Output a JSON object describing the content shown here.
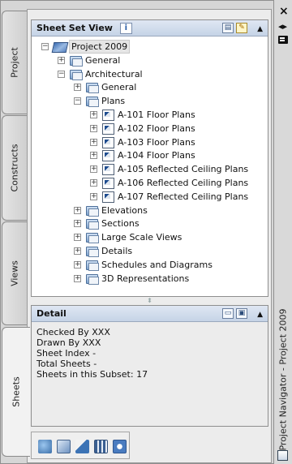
{
  "tabs": [
    {
      "label": "Project"
    },
    {
      "label": "Constructs"
    },
    {
      "label": "Views"
    },
    {
      "label": "Sheets"
    }
  ],
  "sheet_set_view": {
    "title": "Sheet Set View",
    "info_icon": "i"
  },
  "tree": [
    {
      "label": "Project 2009",
      "icon": "project-icon",
      "expander": "−"
    },
    {
      "label": "General",
      "icon": "folder-icon",
      "expander": "+"
    },
    {
      "label": "Architectural",
      "icon": "folder-icon",
      "expander": "−"
    },
    {
      "label": "General",
      "icon": "folder-icon",
      "expander": "+"
    },
    {
      "label": "Plans",
      "icon": "folder-icon",
      "expander": "−"
    },
    {
      "label": "A-101 Floor Plans",
      "icon": "sheet-icon",
      "expander": "+"
    },
    {
      "label": "A-102 Floor Plans",
      "icon": "sheet-icon",
      "expander": "+"
    },
    {
      "label": "A-103 Floor Plans",
      "icon": "sheet-icon",
      "expander": "+"
    },
    {
      "label": "A-104 Floor Plans",
      "icon": "sheet-icon",
      "expander": "+"
    },
    {
      "label": "A-105 Reflected Ceiling Plans",
      "icon": "sheet-icon",
      "expander": "+"
    },
    {
      "label": "A-106 Reflected Ceiling Plans",
      "icon": "sheet-icon",
      "expander": "+"
    },
    {
      "label": "A-107 Reflected Ceiling Plans",
      "icon": "sheet-icon",
      "expander": "+"
    },
    {
      "label": "Elevations",
      "icon": "folder-icon",
      "expander": "+"
    },
    {
      "label": "Sections",
      "icon": "folder-icon",
      "expander": "+"
    },
    {
      "label": "Large Scale Views",
      "icon": "folder-icon",
      "expander": "+"
    },
    {
      "label": "Details",
      "icon": "folder-icon",
      "expander": "+"
    },
    {
      "label": "Schedules and Diagrams",
      "icon": "folder-icon",
      "expander": "+"
    },
    {
      "label": "3D Representations",
      "icon": "folder-icon",
      "expander": "+"
    }
  ],
  "detail": {
    "title": "Detail",
    "lines": [
      "Checked By XXX",
      "Drawn By XXX",
      "Sheet Index -",
      "Total Sheets -",
      "Sheets in this Subset: 17"
    ]
  },
  "right_strip": {
    "close": "×",
    "vertical_title": "Project Navigator - Project 2009"
  },
  "colors": {
    "header_gradient_top": "#dfe7f3",
    "header_gradient_bottom": "#c5d3e6",
    "panel_bg": "#ffffff",
    "frame_bg": "#d6d6d6"
  }
}
